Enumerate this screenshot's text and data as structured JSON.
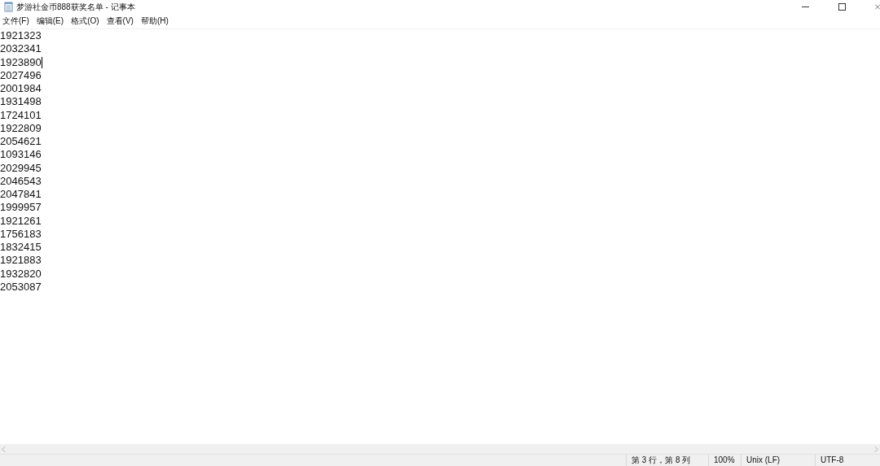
{
  "window": {
    "title": "梦游社金币888获奖名单 - 记事本"
  },
  "menu": [
    "文件(F)",
    "编辑(E)",
    "格式(O)",
    "查看(V)",
    "帮助(H)"
  ],
  "lines": [
    {
      "text": "1921323",
      "caret": false
    },
    {
      "text": "2032341",
      "caret": false
    },
    {
      "text": "1923890",
      "caret": true
    },
    {
      "text": "2027496",
      "caret": false
    },
    {
      "text": "2001984",
      "caret": false
    },
    {
      "text": "1931498",
      "caret": false
    },
    {
      "text": "1724101",
      "caret": false
    },
    {
      "text": "1922809",
      "caret": false
    },
    {
      "text": "2054621",
      "caret": false
    },
    {
      "text": "1093146",
      "caret": false
    },
    {
      "text": "2029945",
      "caret": false
    },
    {
      "text": "2046543",
      "caret": false
    },
    {
      "text": "2047841",
      "caret": false
    },
    {
      "text": "1999957",
      "caret": false
    },
    {
      "text": "1921261",
      "caret": false
    },
    {
      "text": "1756183",
      "caret": false
    },
    {
      "text": "1832415",
      "caret": false
    },
    {
      "text": "1921883",
      "caret": false
    },
    {
      "text": "1932820",
      "caret": false
    },
    {
      "text": "2053087",
      "caret": false
    }
  ],
  "status_bar": {
    "position": "第 3 行，第 8 列",
    "zoom": "100%",
    "line_ending": "Unix (LF)",
    "encoding": "UTF-8"
  }
}
